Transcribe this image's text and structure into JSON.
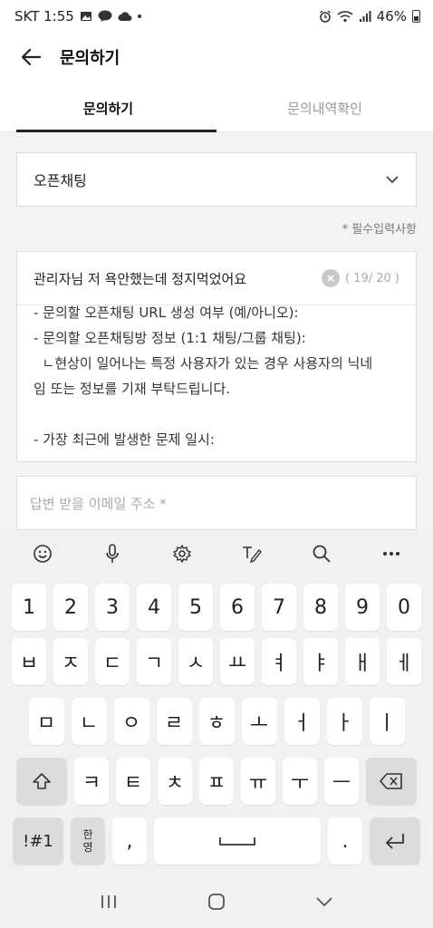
{
  "status_bar": {
    "carrier_time": "SKT 1:55",
    "battery": "46%"
  },
  "app_bar": {
    "title": "문의하기"
  },
  "tabs": [
    {
      "label": "문의하기",
      "active": true
    },
    {
      "label": "문의내역확인",
      "active": false
    }
  ],
  "form": {
    "category_value": "오픈채팅",
    "required_note": "* 필수입력사항",
    "title_value": "관리자님 저 욕안했는데 정지먹었어요",
    "char_count": "( 19/ 20 )",
    "body_lines": [
      "- 문의할 오픈채팅 URL 생성 여부 (예/아니오):",
      "- 문의할 오픈채팅방 정보 (1:1 채팅/그룹 채팅):",
      "  ㄴ현상이 일어나는 특정 사용자가 있는 경우 사용자의 닉네",
      "임 또는 정보를 기재 부탁드립니다.",
      "",
      "- 가장 최근에 발생한 문제 일시:"
    ],
    "email_placeholder": "답변 받을 이메일 주소 *"
  },
  "keyboard": {
    "number_row": [
      "1",
      "2",
      "3",
      "4",
      "5",
      "6",
      "7",
      "8",
      "9",
      "0"
    ],
    "row1": [
      "ㅂ",
      "ㅈ",
      "ㄷ",
      "ㄱ",
      "ㅅ",
      "ㅛ",
      "ㅕ",
      "ㅑ",
      "ㅐ",
      "ㅔ"
    ],
    "row2": [
      "ㅁ",
      "ㄴ",
      "ㅇ",
      "ㄹ",
      "ㅎ",
      "ㅗ",
      "ㅓ",
      "ㅏ",
      "ㅣ"
    ],
    "row3": [
      "ㅋ",
      "ㅌ",
      "ㅊ",
      "ㅍ",
      "ㅠ",
      "ㅜ",
      "ㅡ"
    ],
    "symbols_label": "!#1",
    "lang_label_top": "한",
    "lang_label_bottom": "영",
    "comma_label": ",",
    "period_label": "."
  },
  "colors": {
    "accent": "#222222",
    "content_bg": "#f3f3f3",
    "keyboard_bg": "#f1f1f3"
  }
}
